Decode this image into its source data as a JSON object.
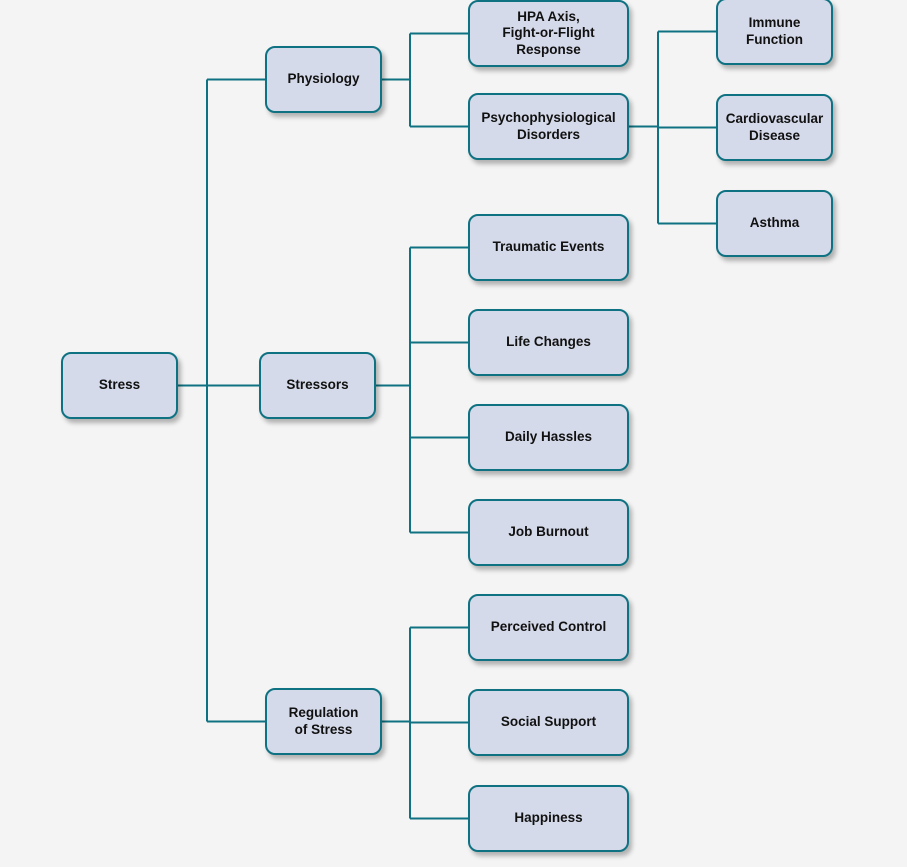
{
  "diagram": {
    "type": "tree",
    "orientation": "left-to-right",
    "colors": {
      "background": "#f4f4f4",
      "node_fill": "#d5daea",
      "node_border": "#0f7282",
      "connector": "#0f7282",
      "text": "#111111"
    },
    "root": {
      "id": "stress",
      "label": "Stress",
      "children": [
        {
          "id": "physiology",
          "label": "Physiology",
          "children": [
            {
              "id": "hpa",
              "label": "HPA Axis,\nFight-or-Flight\nResponse"
            },
            {
              "id": "psycho",
              "label": "Psychophysiological\nDisorders",
              "children": [
                {
                  "id": "immune",
                  "label": "Immune\nFunction"
                },
                {
                  "id": "cardio",
                  "label": "Cardiovascular\nDisease"
                },
                {
                  "id": "asthma",
                  "label": "Asthma"
                }
              ]
            }
          ]
        },
        {
          "id": "stressors",
          "label": "Stressors",
          "children": [
            {
              "id": "trauma",
              "label": "Traumatic Events"
            },
            {
              "id": "life",
              "label": "Life Changes"
            },
            {
              "id": "daily",
              "label": "Daily Hassles"
            },
            {
              "id": "job",
              "label": "Job Burnout"
            }
          ]
        },
        {
          "id": "regulation",
          "label": "Regulation\nof Stress",
          "children": [
            {
              "id": "control",
              "label": "Perceived Control"
            },
            {
              "id": "social",
              "label": "Social Support"
            },
            {
              "id": "happy",
              "label": "Happiness"
            }
          ]
        }
      ]
    }
  }
}
